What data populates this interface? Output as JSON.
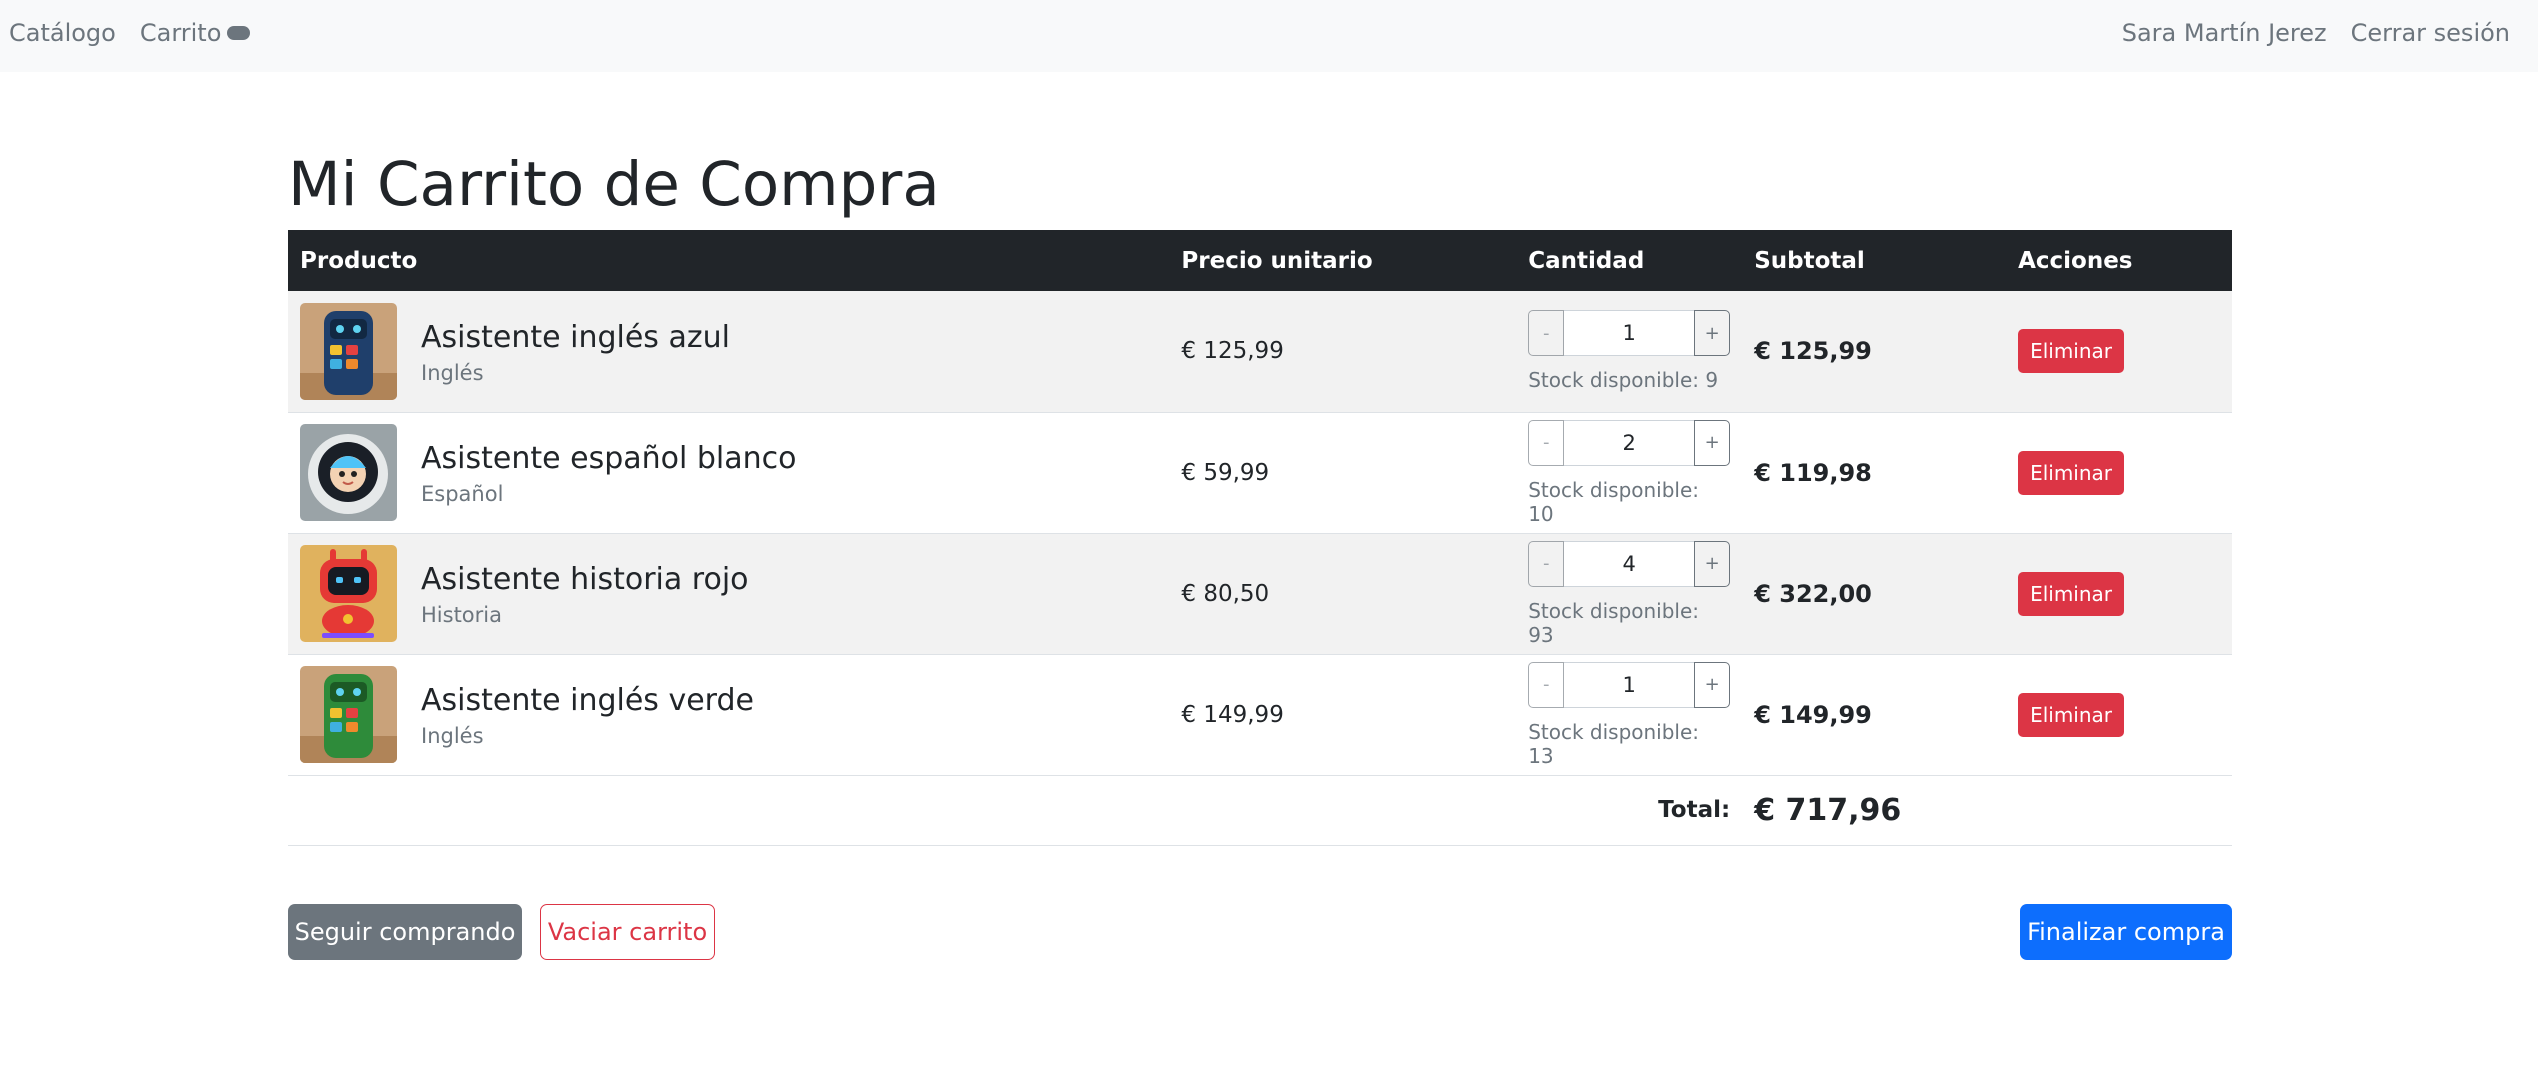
{
  "navbar": {
    "catalog": "Catálogo",
    "cart": "Carrito",
    "user": "Sara Martín Jerez",
    "logout": "Cerrar sesión"
  },
  "page": {
    "title": "Mi Carrito de Compra"
  },
  "table": {
    "headers": [
      "Producto",
      "Precio unitario",
      "Cantidad",
      "Subtotal",
      "Acciones"
    ],
    "rows": [
      {
        "name": "Asistente inglés azul",
        "category": "Inglés",
        "price": "€ 125,99",
        "quantity": "1",
        "stock": "Stock disponible: 9",
        "subtotal": "€ 125,99",
        "action": "Eliminar"
      },
      {
        "name": "Asistente español blanco",
        "category": "Español",
        "price": "€ 59,99",
        "quantity": "2",
        "stock": "Stock disponible: 10",
        "subtotal": "€ 119,98",
        "action": "Eliminar"
      },
      {
        "name": "Asistente historia rojo",
        "category": "Historia",
        "price": "€ 80,50",
        "quantity": "4",
        "stock": "Stock disponible: 93",
        "subtotal": "€ 322,00",
        "action": "Eliminar"
      },
      {
        "name": "Asistente inglés verde",
        "category": "Inglés",
        "price": "€ 149,99",
        "quantity": "1",
        "stock": "Stock disponible: 13",
        "subtotal": "€ 149,99",
        "action": "Eliminar"
      }
    ],
    "total_label": "Total:",
    "total_value": "€ 717,96",
    "minus": "-",
    "plus": "+"
  },
  "actions": {
    "continue": "Seguir comprando",
    "empty": "Vaciar carrito",
    "checkout": "Finalizar compra"
  },
  "colors": {
    "navbar_bg": "#f8f9fa",
    "header_bg": "#212529",
    "danger": "#dc3545",
    "primary": "#0d6efd",
    "secondary": "#6c757d"
  }
}
